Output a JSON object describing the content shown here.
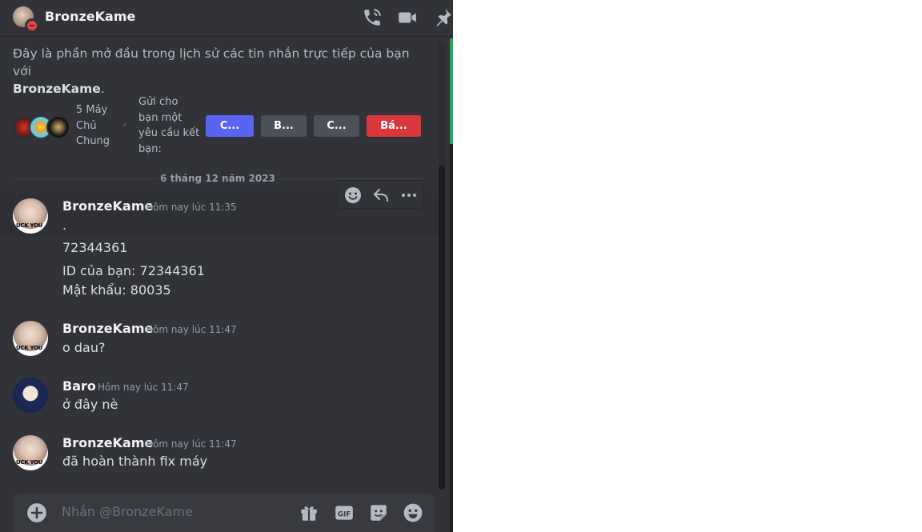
{
  "header": {
    "title": "BronzeKame",
    "status": "do-not-disturb",
    "icons": [
      "voice-call-icon",
      "video-call-icon",
      "pin-icon"
    ]
  },
  "intro": {
    "text": "Đây là phần mở đầu trong lịch sử các tin nhắn trực tiếp của bạn với",
    "name": "BronzeKame",
    "end": "."
  },
  "mutual": {
    "servers_line1": "5 Máy",
    "servers_line2": "Chủ",
    "servers_line3": "Chung",
    "request_line1": "Gửi cho",
    "request_line2": "bạn một",
    "request_line3": "yêu cầu kết",
    "request_line4": "bạn:",
    "buttons": [
      "C...",
      "B...",
      "C...",
      "Bá..."
    ]
  },
  "divider": {
    "date": "6 tháng 12 năm 2023"
  },
  "messages": [
    {
      "author": "BronzeKame",
      "time": "Hôm nay lúc 11:35",
      "lines": [
        ".",
        "72344361",
        "ID của bạn: 72344361",
        "Mật khẩu: 80035"
      ]
    },
    {
      "author": "BronzeKame",
      "time": "Hôm nay lúc 11:47",
      "lines": [
        "o dau?"
      ]
    },
    {
      "author": "Baro",
      "time": "Hôm nay lúc 11:47",
      "lines": [
        "ở đây nè"
      ]
    },
    {
      "author": "BronzeKame",
      "time": "Hôm nay lúc 11:47",
      "lines": [
        "đã hoàn thành fix máy"
      ]
    }
  ],
  "composer": {
    "placeholder": "Nhắn @BronzeKame"
  },
  "colors": {
    "background": "#313338",
    "accent": "#5865f2",
    "danger": "#da373c",
    "online_bar": "#23a55a"
  }
}
